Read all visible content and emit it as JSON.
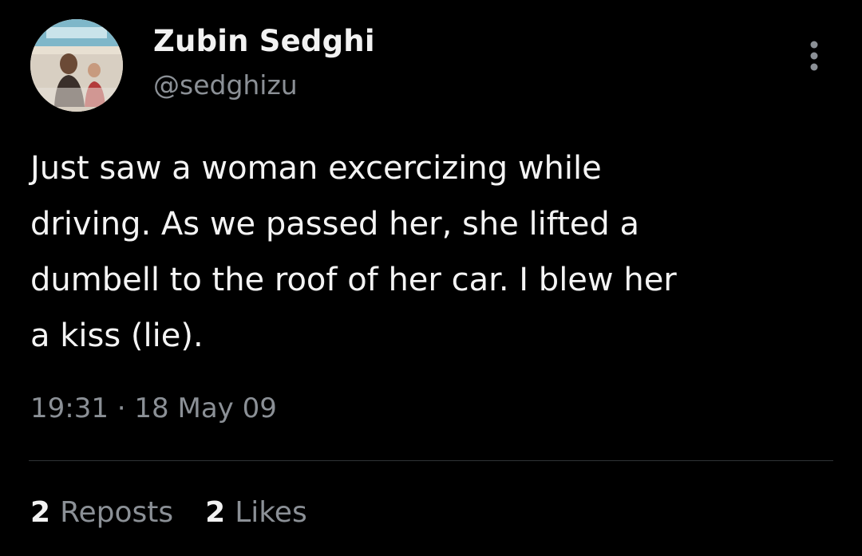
{
  "author": {
    "display_name": "Zubin Sedghi",
    "handle": "@sedghizu",
    "avatar_icon": "profile-photo"
  },
  "menu": {
    "icon": "more-vertical-icon"
  },
  "tweet": {
    "text": "Just saw a woman excercizing while\ndriving. As we passed her, she lifted a\ndumbell to the roof of her car.  I blew her\na kiss (lie).",
    "time": "19:31",
    "separator": "·",
    "date": "18 May 09"
  },
  "stats": {
    "reposts_count": "2",
    "reposts_label": "Reposts",
    "likes_count": "2",
    "likes_label": "Likes"
  },
  "colors": {
    "background": "#000000",
    "primary_text": "#e7e9ea",
    "secondary_text": "#8b9096",
    "divider": "#2f3336"
  }
}
